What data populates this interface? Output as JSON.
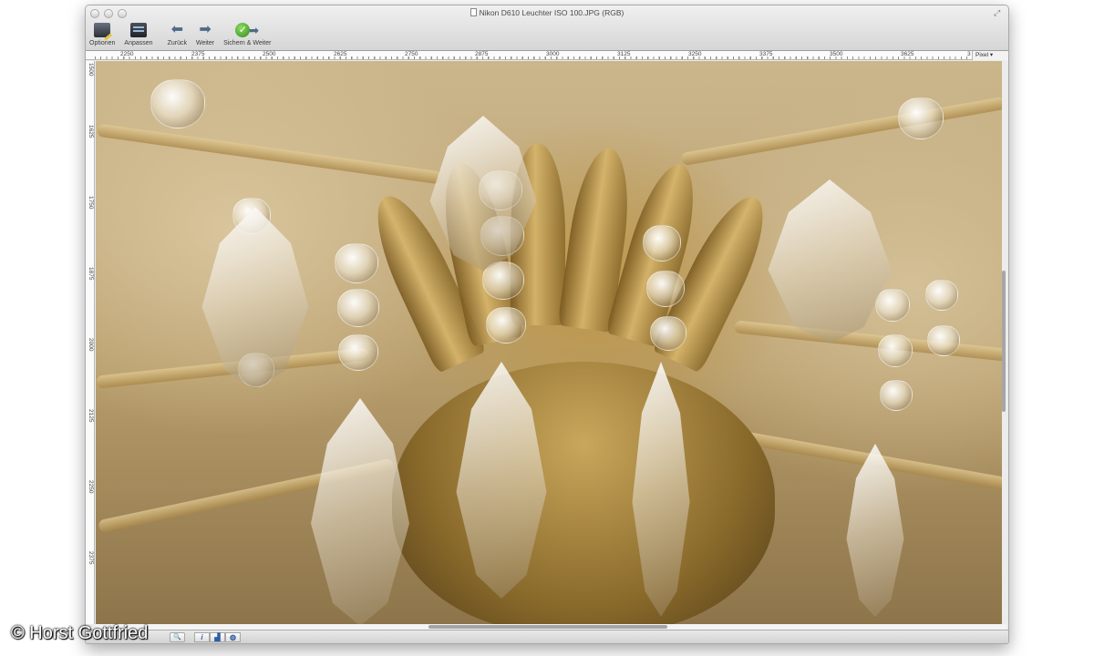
{
  "window": {
    "title": "Nikon D610 Leuchter ISO 100.JPG (RGB)"
  },
  "toolbar": {
    "items": [
      {
        "label": "Optionen",
        "icon": "options-icon"
      },
      {
        "label": "Anpassen",
        "icon": "adjust-icon"
      },
      {
        "label": "Zurück",
        "icon": "arrow-left-icon"
      },
      {
        "label": "Weiter",
        "icon": "arrow-right-icon"
      },
      {
        "label": "Sichern & Weiter",
        "icon": "save-next-icon"
      }
    ]
  },
  "ruler_h": {
    "labels": [
      "2250",
      "2375",
      "2500",
      "2625",
      "2750",
      "2875",
      "3000",
      "3125",
      "3250",
      "3375",
      "3500",
      "3625",
      "3"
    ],
    "unit": "Pixel"
  },
  "ruler_v": {
    "labels": [
      "1500",
      "1625",
      "1750",
      "1875",
      "2000",
      "2125",
      "2250",
      "2375"
    ]
  },
  "statusbar": {
    "buttons": [
      "zoom-icon",
      "info-icon",
      "histogram-icon",
      "globe-icon"
    ],
    "zoom_glyph": "🔍",
    "info_glyph": "i",
    "hist_glyph": "▟",
    "globe_glyph": "◍"
  },
  "image": {
    "subject": "crystal-chandelier-photo"
  },
  "watermark": "© Horst Gottfried"
}
